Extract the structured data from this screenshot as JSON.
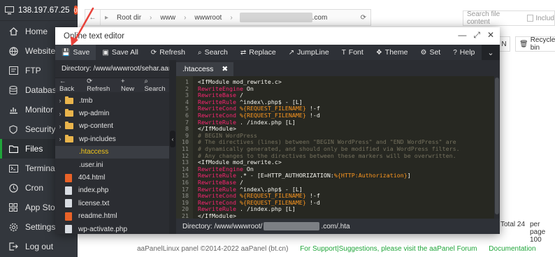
{
  "sidebar": {
    "ip": "138.197.67.25",
    "badge": "0",
    "items": [
      {
        "label": "Home"
      },
      {
        "label": "Website"
      },
      {
        "label": "FTP"
      },
      {
        "label": "Databases"
      },
      {
        "label": "Monitor"
      },
      {
        "label": "Security"
      },
      {
        "label": "Files"
      },
      {
        "label": "Terminal"
      },
      {
        "label": "Cron"
      },
      {
        "label": "App Store"
      },
      {
        "label": "Settings"
      },
      {
        "label": "Log out"
      }
    ]
  },
  "filemanager": {
    "path": [
      "Root dir",
      "www",
      "wwwroot"
    ],
    "path_suffix": ".com",
    "search_placeholder": "Search file content",
    "include_label": "Includ",
    "n_button": "N",
    "recycle_label": "Recycle bin",
    "total": "Total 24",
    "per_page": "per page",
    "per_page_value": "100"
  },
  "footer": {
    "copyright": "aaPanelLinux panel ©2014-2022 aaPanel (bt.cn)",
    "support": "For Support|Suggestions, please visit the aaPanel Forum",
    "docs": "Documentation"
  },
  "editor": {
    "title": "Online text editor",
    "toolbar": [
      {
        "label": "Save",
        "icon": "save-icon"
      },
      {
        "label": "Save All",
        "icon": "save-all-icon"
      },
      {
        "label": "Refresh",
        "icon": "refresh-icon"
      },
      {
        "label": "Search",
        "icon": "search-icon"
      },
      {
        "label": "Replace",
        "icon": "replace-icon"
      },
      {
        "label": "JumpLine",
        "icon": "jumpline-icon"
      },
      {
        "label": "Font",
        "icon": "font-icon"
      },
      {
        "label": "Theme",
        "icon": "theme-icon"
      },
      {
        "label": "Set",
        "icon": "gear-icon"
      },
      {
        "label": "Help",
        "icon": "help-icon"
      }
    ],
    "directory_label": "Directory: /www/wwwroot/sehar.aamir...",
    "actions": {
      "back": "Back",
      "refresh": "Refresh",
      "new": "New",
      "search": "Search"
    },
    "files": [
      {
        "name": ".tmb",
        "type": "folder"
      },
      {
        "name": "wp-admin",
        "type": "folder"
      },
      {
        "name": "wp-content",
        "type": "folder"
      },
      {
        "name": "wp-includes",
        "type": "folder"
      },
      {
        "name": ".htaccess",
        "type": "file",
        "selected": true
      },
      {
        "name": ".user.ini",
        "type": "file"
      },
      {
        "name": "404.html",
        "type": "html"
      },
      {
        "name": "index.php",
        "type": "doc"
      },
      {
        "name": "license.txt",
        "type": "doc"
      },
      {
        "name": "readme.html",
        "type": "html"
      },
      {
        "name": "wp-activate.php",
        "type": "doc"
      }
    ],
    "tab_name": ".htaccess",
    "status_prefix": "Directory: /www/wwwroot/",
    "status_suffix": ".com/.hta",
    "code_lines": [
      {
        "n": "1",
        "parts": [
          [
            "tag",
            "<IfModule mod_rewrite.c>"
          ]
        ]
      },
      {
        "n": "2",
        "parts": [
          [
            "dir",
            "RewriteEngine"
          ],
          [
            "txt",
            " On"
          ]
        ]
      },
      {
        "n": "3",
        "parts": [
          [
            "dir",
            "RewriteBase"
          ],
          [
            "txt",
            " /"
          ]
        ]
      },
      {
        "n": "4",
        "parts": [
          [
            "dir",
            "RewriteRule"
          ],
          [
            "txt",
            " ^index\\.php$ - [L]"
          ]
        ]
      },
      {
        "n": "5",
        "parts": [
          [
            "dir",
            "RewriteCond"
          ],
          [
            "txt",
            " "
          ],
          [
            "var",
            "%{REQUEST_FILENAME}"
          ],
          [
            "txt",
            " !-f"
          ]
        ]
      },
      {
        "n": "6",
        "parts": [
          [
            "dir",
            "RewriteCond"
          ],
          [
            "txt",
            " "
          ],
          [
            "var",
            "%{REQUEST_FILENAME}"
          ],
          [
            "txt",
            " !-d"
          ]
        ]
      },
      {
        "n": "7",
        "parts": [
          [
            "dir",
            "RewriteRule"
          ],
          [
            "txt",
            " . /index.php [L]"
          ]
        ]
      },
      {
        "n": "8",
        "parts": [
          [
            "tag",
            "</IfModule>"
          ]
        ]
      },
      {
        "n": "9",
        "parts": [
          [
            "com",
            "# BEGIN WordPress"
          ]
        ]
      },
      {
        "n": "10",
        "parts": [
          [
            "com",
            "# The directives (lines) between \"BEGIN WordPress\" and \"END WordPress\" are"
          ]
        ]
      },
      {
        "n": "11",
        "parts": [
          [
            "com",
            "# dynamically generated, and should only be modified via WordPress filters."
          ]
        ]
      },
      {
        "n": "12",
        "parts": [
          [
            "com",
            "# Any changes to the directives between these markers will be overwritten."
          ]
        ]
      },
      {
        "n": "13",
        "parts": [
          [
            "tag",
            "<IfModule mod_rewrite.c>"
          ]
        ]
      },
      {
        "n": "14",
        "parts": [
          [
            "dir",
            "RewriteEngine"
          ],
          [
            "txt",
            " On"
          ]
        ]
      },
      {
        "n": "15",
        "parts": [
          [
            "dir",
            "RewriteRule"
          ],
          [
            "txt",
            " .* - [E=HTTP_AUTHORIZATION:"
          ],
          [
            "var",
            "%{HTTP:Authorization}"
          ],
          [
            "txt",
            "]"
          ]
        ]
      },
      {
        "n": "16",
        "parts": [
          [
            "dir",
            "RewriteBase"
          ],
          [
            "txt",
            " /"
          ]
        ]
      },
      {
        "n": "17",
        "parts": [
          [
            "dir",
            "RewriteRule"
          ],
          [
            "txt",
            " ^index\\.php$ - [L]"
          ]
        ]
      },
      {
        "n": "18",
        "parts": [
          [
            "dir",
            "RewriteCond"
          ],
          [
            "txt",
            " "
          ],
          [
            "var",
            "%{REQUEST_FILENAME}"
          ],
          [
            "txt",
            " !-f"
          ]
        ]
      },
      {
        "n": "19",
        "parts": [
          [
            "dir",
            "RewriteCond"
          ],
          [
            "txt",
            " "
          ],
          [
            "var",
            "%{REQUEST_FILENAME}"
          ],
          [
            "txt",
            " !-d"
          ]
        ]
      },
      {
        "n": "20",
        "parts": [
          [
            "dir",
            "RewriteRule"
          ],
          [
            "txt",
            " . /index.php [L]"
          ]
        ]
      },
      {
        "n": "21",
        "parts": [
          [
            "tag",
            "</IfModule>"
          ]
        ]
      }
    ]
  },
  "colors": {
    "sidebar_bg": "#33373d",
    "accent_green": "#20a53a",
    "editor_bg": "#272822",
    "directive": "#f92672",
    "variable": "#fd971f",
    "comment": "#75715e",
    "annotation_arrow": "#e8423a"
  }
}
